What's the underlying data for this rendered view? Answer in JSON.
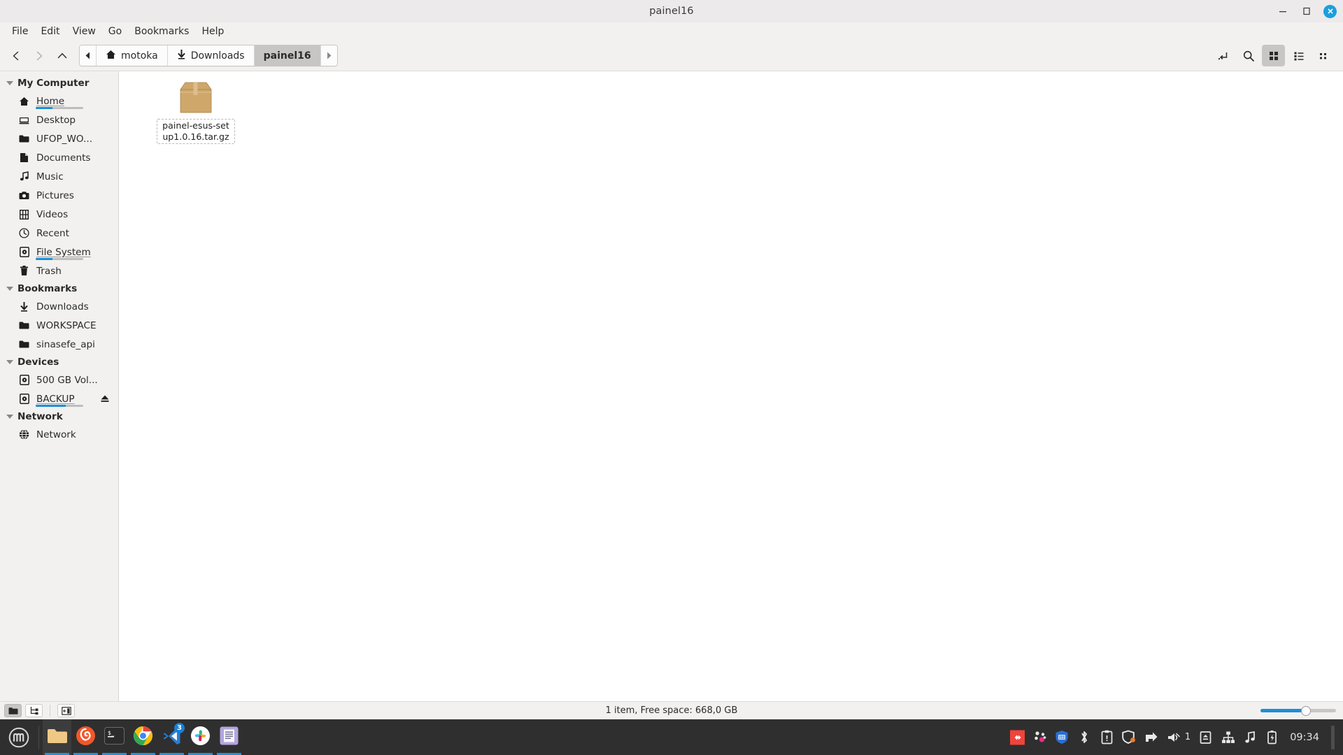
{
  "window": {
    "title": "painel16",
    "controls": {
      "minimize": "minimize-button",
      "maximize": "maximize-button",
      "close": "close-button"
    }
  },
  "menubar": {
    "items": [
      {
        "label": "File"
      },
      {
        "label": "Edit"
      },
      {
        "label": "View"
      },
      {
        "label": "Go"
      },
      {
        "label": "Bookmarks"
      },
      {
        "label": "Help"
      }
    ]
  },
  "toolbar": {
    "nav": [
      {
        "name": "back-button",
        "icon": "chevron-left-icon",
        "disabled": false
      },
      {
        "name": "forward-button",
        "icon": "chevron-right-icon",
        "disabled": true
      },
      {
        "name": "up-button",
        "icon": "chevron-up-icon",
        "disabled": false
      }
    ],
    "breadcrumb": {
      "scroll_left": "◀",
      "scroll_right": "▶",
      "crumbs": [
        {
          "label": "motoka",
          "icon": "home-icon",
          "active": false
        },
        {
          "label": "Downloads",
          "icon": "download-arrow-icon",
          "active": false
        },
        {
          "label": "painel16",
          "icon": "",
          "active": true
        }
      ]
    },
    "right_buttons": [
      {
        "name": "toggle-path-entry-button",
        "icon": "path-entry-icon",
        "active": false
      },
      {
        "name": "search-button",
        "icon": "search-icon",
        "active": false
      },
      {
        "name": "icon-view-button",
        "icon": "grid-view-icon",
        "active": true
      },
      {
        "name": "list-view-button",
        "icon": "list-view-icon",
        "active": false
      },
      {
        "name": "compact-view-button",
        "icon": "compact-view-icon",
        "active": false
      }
    ]
  },
  "sidebar": {
    "groups": [
      {
        "title": "My Computer",
        "name": "sidebar-group-my-computer",
        "items": [
          {
            "label": "Home",
            "icon": "home-icon",
            "usage": 36,
            "underline": true
          },
          {
            "label": "Desktop",
            "icon": "desktop-icon"
          },
          {
            "label": "UFOP_WO...",
            "icon": "folder-icon"
          },
          {
            "label": "Documents",
            "icon": "document-icon"
          },
          {
            "label": "Music",
            "icon": "music-note-icon"
          },
          {
            "label": "Pictures",
            "icon": "camera-icon"
          },
          {
            "label": "Videos",
            "icon": "film-icon"
          },
          {
            "label": "Recent",
            "icon": "clock-icon"
          },
          {
            "label": "File System",
            "icon": "drive-icon",
            "usage": 36,
            "underline": true
          },
          {
            "label": "Trash",
            "icon": "trash-icon"
          }
        ]
      },
      {
        "title": "Bookmarks",
        "name": "sidebar-group-bookmarks",
        "items": [
          {
            "label": "Downloads",
            "icon": "download-arrow-icon"
          },
          {
            "label": "WORKSPACE",
            "icon": "folder-icon"
          },
          {
            "label": "sinasefe_api",
            "icon": "folder-icon"
          }
        ]
      },
      {
        "title": "Devices",
        "name": "sidebar-group-devices",
        "items": [
          {
            "label": "500 GB Vol...",
            "icon": "drive-icon"
          },
          {
            "label": "BACKUP",
            "icon": "drive-icon",
            "usage": 63,
            "underline": true,
            "eject": true
          }
        ]
      },
      {
        "title": "Network",
        "name": "sidebar-group-network",
        "items": [
          {
            "label": "Network",
            "icon": "globe-icon"
          }
        ]
      }
    ]
  },
  "fileview": {
    "files": [
      {
        "name": "painel-esus-setup1.0.16.tar.gz",
        "icon": "archive-box-icon",
        "selected": true
      }
    ]
  },
  "statusbar": {
    "buttons": [
      {
        "name": "icon-view-toggle",
        "icon": "folder-icon",
        "active": true
      },
      {
        "name": "tree-view-toggle",
        "icon": "tree-icon",
        "active": false
      },
      {
        "name": "sidebar-toggle",
        "icon": "sidebar-panel-icon",
        "active": false
      }
    ],
    "status_text": "1 item, Free space: 668,0 GB",
    "zoom_percent": 60
  },
  "taskbar": {
    "menu_button": "linux-mint-menu-icon",
    "apps": [
      {
        "name": "file-manager",
        "icon": "folder-icon",
        "active": true,
        "running": true
      },
      {
        "name": "firefox",
        "icon": "firefox-icon",
        "active": false,
        "running": true
      },
      {
        "name": "terminal",
        "icon": "terminal-icon",
        "active": false,
        "running": true
      },
      {
        "name": "chrome",
        "icon": "chrome-icon",
        "active": false,
        "running": true
      },
      {
        "name": "vscode",
        "icon": "vscode-icon",
        "active": false,
        "running": true,
        "badge": "3"
      },
      {
        "name": "slack",
        "icon": "slack-icon",
        "active": false,
        "running": true
      },
      {
        "name": "text-editor",
        "icon": "text-editor-icon",
        "active": false,
        "running": true
      }
    ],
    "tray": [
      {
        "name": "anydesk-tray-icon"
      },
      {
        "name": "dots-tray-icon"
      },
      {
        "name": "shield-blue-tray-icon"
      },
      {
        "name": "bluetooth-tray-icon"
      },
      {
        "name": "clipboard-tray-icon"
      },
      {
        "name": "security-shield-tray-icon"
      },
      {
        "name": "update-manager-tray-icon"
      },
      {
        "name": "volume-tray-icon",
        "label": "1"
      },
      {
        "name": "removable-media-tray-icon"
      },
      {
        "name": "network-tray-icon"
      },
      {
        "name": "music-tray-icon"
      },
      {
        "name": "battery-tray-icon"
      }
    ],
    "clock": "09:34"
  },
  "colors": {
    "accent": "#1b8fd6",
    "window_bg": "#f2f1f0",
    "fileview_bg": "#ffffff",
    "taskbar_bg": "#2f2f2f",
    "archive_icon": "#cfa76a"
  }
}
